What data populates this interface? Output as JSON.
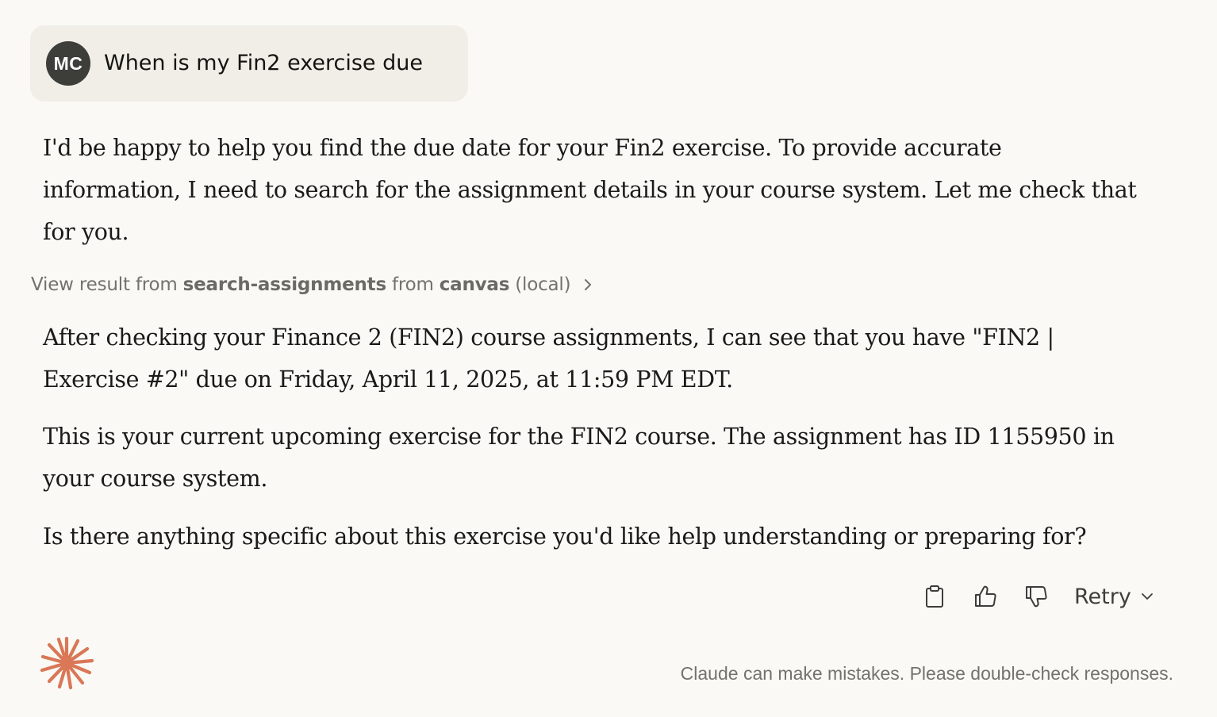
{
  "user_message": {
    "avatar_initials": "MC",
    "text": "When is my Fin2 exercise due"
  },
  "assistant": {
    "intro": "I'd be happy to help you find the due date for your Fin2 exercise. To provide accurate information, I need to search for the assignment details in your course system. Let me check that for you.",
    "tool_result": {
      "prefix": "View result from",
      "tool_name": "search-assignments",
      "middle": "from",
      "source": "canvas",
      "suffix": "(local)"
    },
    "paragraphs": [
      "After checking your Finance 2 (FIN2) course assignments, I can see that you have \"FIN2 | Exercise #2\" due on Friday, April 11, 2025, at 11:59 PM EDT.",
      "This is your current upcoming exercise for the FIN2 course. The assignment has ID 1155950 in your course system.",
      "Is there anything specific about this exercise you'd like help understanding or preparing for?"
    ]
  },
  "actions": {
    "copy_icon": "clipboard-icon",
    "thumbs_up_icon": "thumbs-up-icon",
    "thumbs_down_icon": "thumbs-down-icon",
    "retry_label": "Retry"
  },
  "footer": {
    "disclaimer": "Claude can make mistakes. Please double-check responses."
  },
  "colors": {
    "background": "#faf9f5",
    "user_bubble": "#f0eee6",
    "avatar": "#3d3d3a",
    "brand_accent": "#d97757"
  }
}
